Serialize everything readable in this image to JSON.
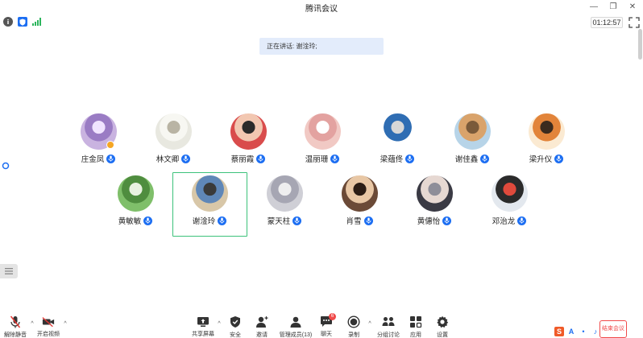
{
  "window": {
    "title": "腾讯会议",
    "controls": [
      "minimize",
      "restore",
      "close"
    ]
  },
  "status": {
    "timer": "01:12:57"
  },
  "speaking": {
    "text": "正在讲话: 谢淦玲;"
  },
  "participants": [
    {
      "name": "庄金凤",
      "mic": "on",
      "host": true,
      "colors": [
        "#c9b3e0",
        "#9a7cc4",
        "#f0e4ff"
      ]
    },
    {
      "name": "林文卿",
      "mic": "on",
      "host": false,
      "colors": [
        "#e8e8e0",
        "#f7f7f2",
        "#b9b4a4"
      ]
    },
    {
      "name": "蔡丽霞",
      "mic": "on",
      "host": false,
      "colors": [
        "#d94c4c",
        "#f2c7b1",
        "#2b2b2b"
      ]
    },
    {
      "name": "温丽珊",
      "mic": "on",
      "host": false,
      "colors": [
        "#f1c9c4",
        "#e3a2a0",
        "#ffffff"
      ]
    },
    {
      "name": "梁蕴佟",
      "mic": "on",
      "host": false,
      "colors": [
        "#ffffff",
        "#2f6db3",
        "#d7d7d7"
      ]
    },
    {
      "name": "谢佳鑫",
      "mic": "on",
      "host": false,
      "colors": [
        "#b7d4e8",
        "#d9a36b",
        "#7a5a3a"
      ]
    },
    {
      "name": "梁升仪",
      "mic": "on",
      "host": false,
      "colors": [
        "#fbead2",
        "#e2843a",
        "#3b2b1e"
      ]
    },
    {
      "name": "黄敏敏",
      "mic": "on",
      "host": false,
      "colors": [
        "#7fbf6a",
        "#4f8d3f",
        "#e8f1e0"
      ]
    },
    {
      "name": "谢淦玲",
      "mic": "on",
      "host": false,
      "colors": [
        "#d8c7a8",
        "#5f87b8",
        "#3a3a3a"
      ]
    },
    {
      "name": "蒙天柱",
      "mic": "on",
      "host": false,
      "colors": [
        "#cfcfd6",
        "#a6a6b3",
        "#eeeeef"
      ]
    },
    {
      "name": "肖雪",
      "mic": "on",
      "host": false,
      "colors": [
        "#6b4a37",
        "#e8c7a5",
        "#2b1d15"
      ]
    },
    {
      "name": "黄僡怡",
      "mic": "on",
      "host": false,
      "colors": [
        "#3a3a44",
        "#e6d8d2",
        "#8e8e99"
      ]
    },
    {
      "name": "邓治龙",
      "mic": "on",
      "host": false,
      "colors": [
        "#e3e8ee",
        "#2b2b2b",
        "#e04a3c"
      ]
    }
  ],
  "toolbar": {
    "unmute": "解除静音",
    "start_video": "开启视频",
    "share_screen": "共享屏幕",
    "security": "安全",
    "invite": "邀请",
    "manage_members": "管理成员(13)",
    "chat": "聊天",
    "chat_badge": "6",
    "record": "录制",
    "breakout": "分组讨论",
    "apps": "应用",
    "settings": "设置",
    "end_meeting": "结束会议"
  },
  "colors": {
    "accent": "#1c6ef2",
    "active_speaker": "#3cc27a",
    "danger": "#f04a4a",
    "banner": "#e3ecfb"
  }
}
